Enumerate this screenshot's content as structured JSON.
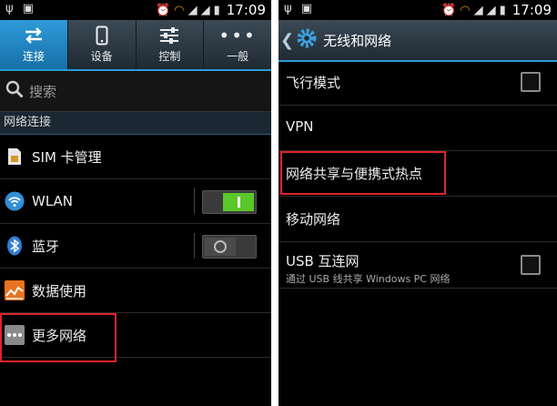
{
  "status_bar": {
    "time": "17:09"
  },
  "left": {
    "tabs": [
      {
        "label": "连接",
        "icon": "swap-arrows-icon"
      },
      {
        "label": "设备",
        "icon": "phone-icon"
      },
      {
        "label": "控制",
        "icon": "sliders-icon"
      },
      {
        "label": "一般",
        "icon": "more-dots-icon"
      }
    ],
    "search_placeholder": "搜索",
    "section_title": "网络连接",
    "items": [
      {
        "label": "SIM 卡管理",
        "icon": "sim-card-icon"
      },
      {
        "label": "WLAN",
        "icon": "wifi-icon",
        "toggle": "on"
      },
      {
        "label": "蓝牙",
        "icon": "bluetooth-icon",
        "toggle": "off"
      },
      {
        "label": "数据使用",
        "icon": "data-usage-icon"
      },
      {
        "label": "更多网络",
        "icon": "more-networks-icon"
      }
    ]
  },
  "right": {
    "title": "无线和网络",
    "items": [
      {
        "label": "飞行模式",
        "checkbox": false
      },
      {
        "label": "VPN"
      },
      {
        "label": "网络共享与便携式热点"
      },
      {
        "label": "移动网络"
      },
      {
        "label": "USB 互连网",
        "sublabel": "通过 USB 线共享 Windows PC 网络",
        "checkbox": false
      }
    ]
  },
  "colors": {
    "accent": "#2b9bd6",
    "highlight_box": "#e0222a",
    "toggle_on": "#5ac72a"
  }
}
